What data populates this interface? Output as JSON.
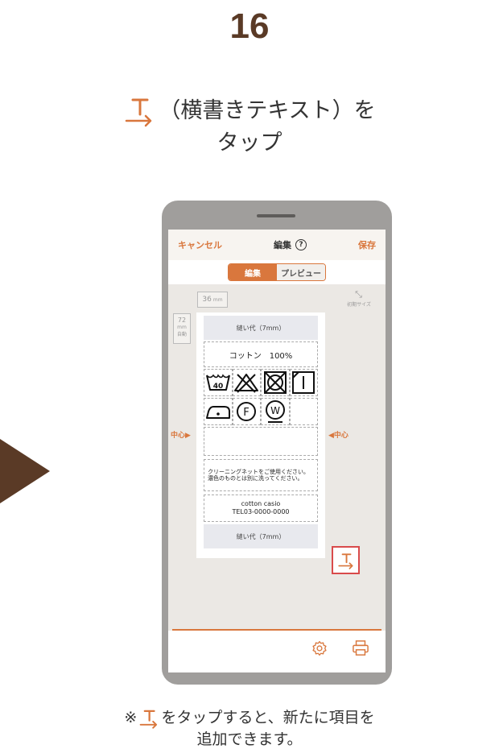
{
  "step_number": "16",
  "instruction": {
    "line1_text": "（横書きテキスト）を",
    "line2_text": "タップ"
  },
  "phone": {
    "header": {
      "cancel": "キャンセル",
      "title": "編集",
      "help_mark": "?",
      "save": "保存"
    },
    "tabs": [
      {
        "label": "編集",
        "active": true
      },
      {
        "label": "プレビュー",
        "active": false
      }
    ],
    "canvas": {
      "width_value": "36",
      "width_unit": "mm",
      "height_value": "72",
      "height_unit": "mm",
      "height_auto": "自動",
      "reset_size_label": "初期サイズ",
      "center_left": "中心▶",
      "center_right": "◀中心"
    },
    "label": {
      "seam_top": "縫い代（7mm）",
      "cotton": "コットン　100%",
      "wash_temperature": "40",
      "note": "クリーニングネットをご使用ください。濃色のものとは別に洗ってください。",
      "contact_line1": "cotton casio",
      "contact_line2": "TEL03-0000-0000",
      "seam_bottom": "縫い代（7mm）"
    }
  },
  "footnote": {
    "prefix": "※",
    "line1_text": "をタップすると、新たに項目を",
    "line2_text": "追加できます。"
  },
  "colors": {
    "accent": "#d9773d",
    "brown": "#5a3a26",
    "highlight_red": "#d94b4b"
  }
}
